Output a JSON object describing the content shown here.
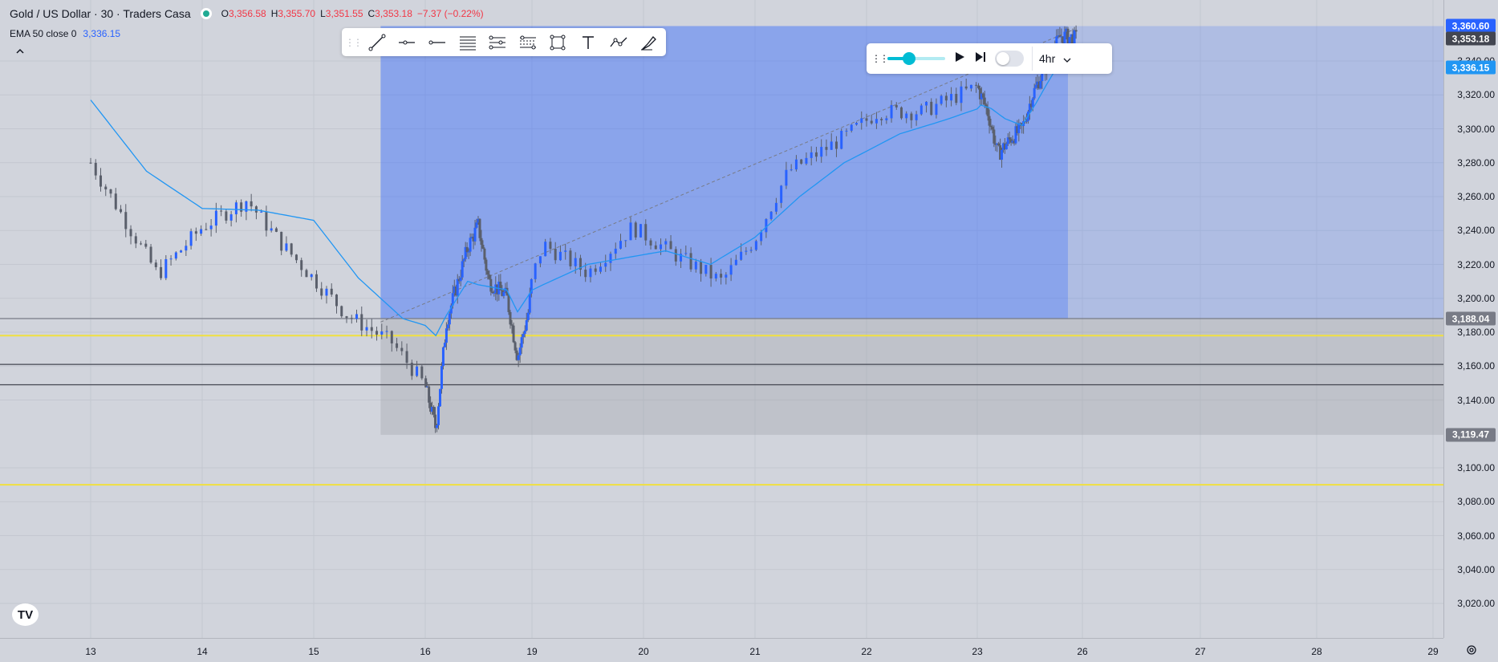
{
  "symbol": {
    "title": "Gold / US Dollar · 30 · Traders Casa",
    "open_label": "O",
    "open": "3,356.58",
    "high_label": "H",
    "high": "3,355.70",
    "low_label": "L",
    "low": "3,351.55",
    "close_label": "C",
    "close": "3,353.18",
    "change": "−7.37 (−0.22%)"
  },
  "indicator": {
    "label": "EMA 50 close 0",
    "value": "3,336.15",
    "color": "#2196f3"
  },
  "drawing_toolbar": {
    "tools": [
      "trend-line-icon",
      "horizontal-ray-icon",
      "horizontal-line-icon",
      "parallel-channel-icon",
      "pitchfork-icon",
      "fib-retracement-icon",
      "rectangle-icon",
      "text-icon",
      "path-icon",
      "brush-icon"
    ]
  },
  "replay": {
    "speed": 0.38,
    "interval": "4hr"
  },
  "price_axis": {
    "ticks": [
      "3,020.00",
      "3,040.00",
      "3,060.00",
      "3,080.00",
      "3,100.00",
      "3,140.00",
      "3,160.00",
      "3,180.00",
      "3,200.00",
      "3,220.00",
      "3,240.00",
      "3,260.00",
      "3,280.00",
      "3,300.00",
      "3,320.00",
      "3,340.00"
    ],
    "labels": [
      {
        "text": "3,360.60",
        "value": 3360.6,
        "color": "#2962ff"
      },
      {
        "text": "3,353.18",
        "value": 3353.18,
        "color": "#434651"
      },
      {
        "text": "3,336.15",
        "value": 3336.15,
        "color": "#2196f3"
      },
      {
        "text": "3,188.04",
        "value": 3188.04,
        "color": "#787b86"
      },
      {
        "text": "3,119.47",
        "value": 3119.47,
        "color": "#787b86"
      }
    ]
  },
  "time_axis": {
    "ticks": [
      "13",
      "14",
      "15",
      "16",
      "19",
      "20",
      "21",
      "22",
      "23",
      "26",
      "27",
      "28",
      "29"
    ]
  },
  "colors": {
    "background": "#d1d4dc",
    "candle": "#5a5f6b",
    "ema": "#2196f3",
    "support": "#f0e040",
    "zone_blue": "#2962ff",
    "zone_gray": "#9598a1"
  },
  "chart_data": {
    "type": "candlestick",
    "price_range": [
      3000,
      3370
    ],
    "horizontal_lines": [
      {
        "price": 3178,
        "color": "#f0e040"
      },
      {
        "price": 3090,
        "color": "#f0e040"
      },
      {
        "price": 3161,
        "color": "#434651"
      },
      {
        "price": 3149,
        "color": "#434651"
      },
      {
        "price": 3188.04,
        "color": "#787b86"
      }
    ],
    "price_path": [
      [
        13,
        3280
      ],
      [
        13.6,
        3214
      ],
      [
        14,
        3242
      ],
      [
        14.4,
        3258
      ],
      [
        14.7,
        3233
      ],
      [
        15.3,
        3190
      ],
      [
        15.7,
        3174
      ],
      [
        16.3,
        3123
      ],
      [
        16.6,
        3186
      ],
      [
        17.2,
        3230
      ],
      [
        17.5,
        3243
      ],
      [
        17.8,
        3210
      ],
      [
        18.3,
        3201
      ],
      [
        18.6,
        3165
      ],
      [
        18.9,
        3192
      ],
      [
        19.1,
        3232
      ],
      [
        19.5,
        3215
      ],
      [
        19.9,
        3242
      ],
      [
        20.3,
        3225
      ],
      [
        20.7,
        3210
      ],
      [
        21.0,
        3235
      ],
      [
        21.3,
        3275
      ],
      [
        21.8,
        3295
      ],
      [
        22.1,
        3310
      ],
      [
        22.5,
        3310
      ],
      [
        23.0,
        3325
      ],
      [
        23.3,
        3310
      ],
      [
        23.6,
        3285
      ],
      [
        24.0,
        3295
      ],
      [
        24.3,
        3300
      ],
      [
        24.6,
        3320
      ],
      [
        25.0,
        3338
      ],
      [
        25.4,
        3355
      ],
      [
        25.85,
        3353.18
      ]
    ],
    "ema_path": [
      [
        13,
        3317
      ],
      [
        13.5,
        3275
      ],
      [
        14,
        3253
      ],
      [
        14.5,
        3252
      ],
      [
        15.0,
        3246
      ],
      [
        15.4,
        3212
      ],
      [
        15.8,
        3188
      ],
      [
        16.3,
        3178
      ],
      [
        16.6,
        3190
      ],
      [
        17.2,
        3210
      ],
      [
        17.5,
        3208
      ],
      [
        18.3,
        3205
      ],
      [
        18.6,
        3192
      ],
      [
        19.1,
        3208
      ],
      [
        19.5,
        3220
      ],
      [
        20.2,
        3228
      ],
      [
        20.6,
        3220
      ],
      [
        21.0,
        3236
      ],
      [
        21.4,
        3260
      ],
      [
        21.8,
        3280
      ],
      [
        22.3,
        3297
      ],
      [
        22.7,
        3305
      ],
      [
        23.1,
        3314
      ],
      [
        23.4,
        3312
      ],
      [
        23.8,
        3306
      ],
      [
        24.3,
        3302
      ],
      [
        24.7,
        3315
      ],
      [
        25.2,
        3333
      ],
      [
        25.85,
        3336.15
      ]
    ],
    "long_position": {
      "start": 15.6,
      "end": 25.6,
      "entry": 3188.04,
      "target": 3360.6,
      "stop": 3119.47
    },
    "dashed_line": [
      [
        15.6,
        3186
      ],
      [
        25.7,
        3358
      ]
    ]
  }
}
